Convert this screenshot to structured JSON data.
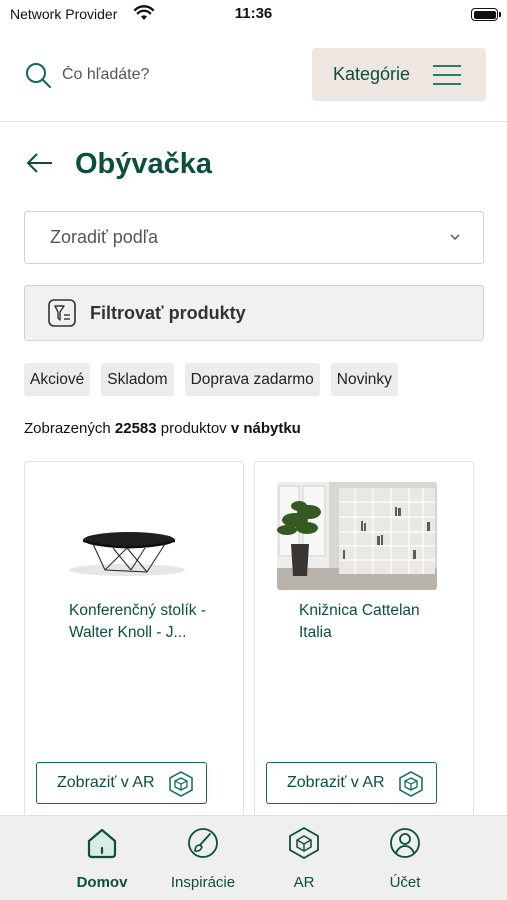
{
  "status_bar": {
    "carrier": "Network Provider",
    "time": "11:36"
  },
  "header": {
    "search_placeholder": "Čo hľadáte?",
    "categories_label": "Kategórie"
  },
  "page": {
    "title": "Obývačka"
  },
  "sort": {
    "label": "Zoradiť podľa"
  },
  "filter": {
    "label": "Filtrovať produkty"
  },
  "chips": [
    "Akciové",
    "Skladom",
    "Doprava zadarmo",
    "Novinky"
  ],
  "results": {
    "prefix": "Zobrazených",
    "count": "22583",
    "middle": "produktov",
    "suffix": "v nábytku"
  },
  "products": [
    {
      "name": "Konferenčný stolík - Walter Knoll - J...",
      "ar_label": "Zobraziť v AR"
    },
    {
      "name": "Knižnica Cattelan Italia",
      "ar_label": "Zobraziť v AR"
    }
  ],
  "bottom_nav": {
    "items": [
      {
        "label": "Domov",
        "icon": "home-icon",
        "active": true
      },
      {
        "label": "Inspirácie",
        "icon": "brush-icon",
        "active": false
      },
      {
        "label": "AR",
        "icon": "ar-cube-icon",
        "active": false
      },
      {
        "label": "Účet",
        "icon": "user-icon",
        "active": false
      }
    ]
  },
  "colors": {
    "brand_green": "#0b4f3c",
    "accent_green": "#0e6a52",
    "category_bg": "#ede6e1",
    "nav_bg": "#efefef"
  }
}
